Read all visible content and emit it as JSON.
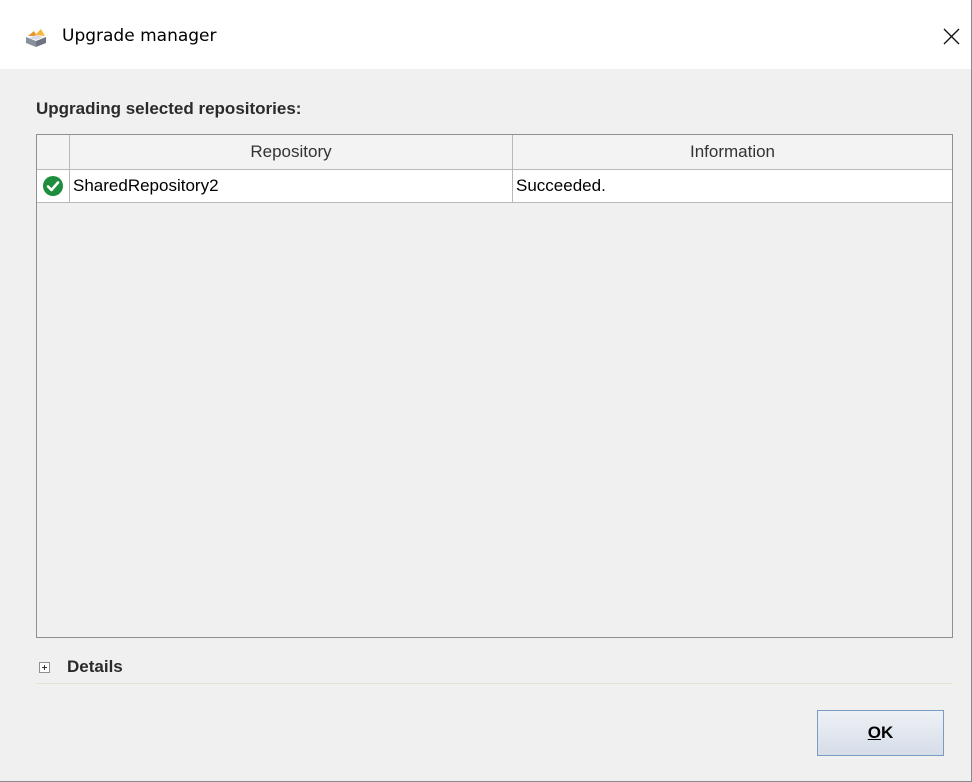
{
  "window": {
    "title": "Upgrade manager",
    "icon": "app-icon",
    "close_icon": "close-icon"
  },
  "main": {
    "section_label": "Upgrading selected repositories:",
    "table": {
      "columns": [
        "",
        "Repository",
        "Information"
      ],
      "rows": [
        {
          "status_icon": "check-circle-icon",
          "status_color": "#1e8e3e",
          "repository": "SharedRepository2",
          "information": "Succeeded."
        }
      ]
    }
  },
  "details": {
    "label": "Details",
    "expanded": false
  },
  "footer": {
    "ok_label": "OK",
    "ok_mnemonic": "O"
  }
}
